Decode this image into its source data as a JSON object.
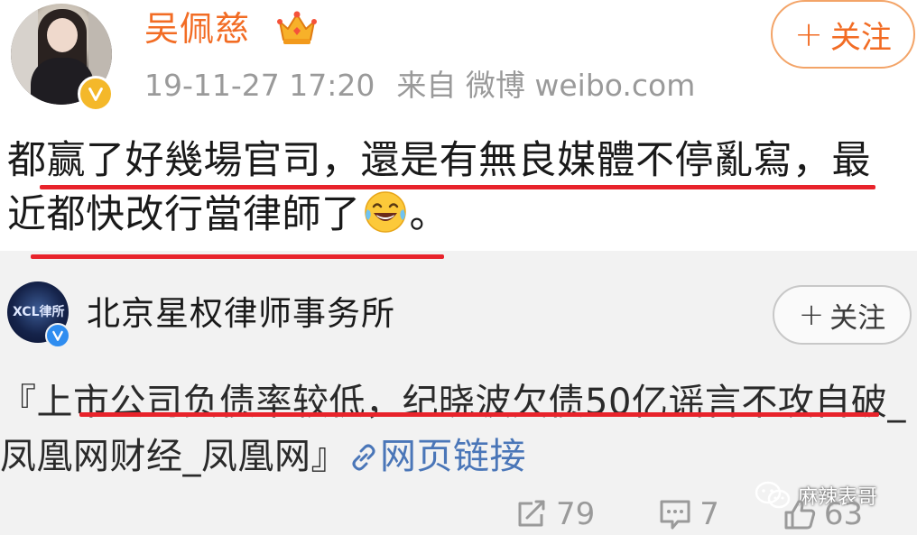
{
  "post": {
    "username": "吴佩慈",
    "timestamp": "19-11-27 17:20",
    "source": "来自 微博 weibo.com",
    "follow_label": "关注",
    "text_part1": "都赢了好幾場官司，還是有無良媒體不停亂寫，最近都快改行當律師了",
    "text_part2": "。",
    "emoji": "laughing-tears-emoji",
    "verified_badge_color": "#f4b82a",
    "username_color": "#f26c24"
  },
  "repost": {
    "avatar_text": "XCL律所",
    "name": "北京星权律师事务所",
    "follow_label": "关注",
    "text": "『上市公司负债率较低，纪晓波欠债50亿谣言不攻自破_凤凰网财经_凤凰网』",
    "link_label": "网页链接",
    "link_color": "#4a76b8"
  },
  "actions": {
    "repost_count": "79",
    "comment_count": "7",
    "like_count": "63"
  },
  "watermark": {
    "label": "麻辣表哥"
  },
  "annotation_color": "#e8232b"
}
